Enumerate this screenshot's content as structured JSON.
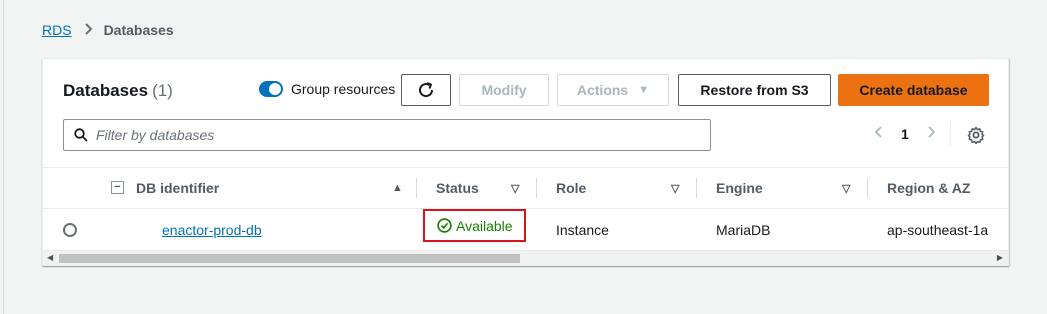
{
  "breadcrumb": {
    "root": "RDS",
    "current": "Databases"
  },
  "panel": {
    "title": "Databases",
    "count": "(1)",
    "group_resources_label": "Group resources",
    "group_resources_on": true
  },
  "toolbar": {
    "modify_label": "Modify",
    "actions_label": "Actions",
    "restore_label": "Restore from S3",
    "create_label": "Create database"
  },
  "filter": {
    "placeholder": "Filter by databases"
  },
  "pagination": {
    "current_page": "1"
  },
  "table": {
    "columns": [
      "DB identifier",
      "Status",
      "Role",
      "Engine",
      "Region & AZ"
    ],
    "rows": [
      {
        "db_identifier": "enactor-prod-db",
        "status": "Available",
        "role": "Instance",
        "engine": "MariaDB",
        "region_az": "ap-southeast-1a"
      }
    ]
  },
  "colors": {
    "accent": "#0073bb",
    "primary": "#ec7211",
    "available": "#1d8102",
    "highlight": "#d9141c"
  }
}
